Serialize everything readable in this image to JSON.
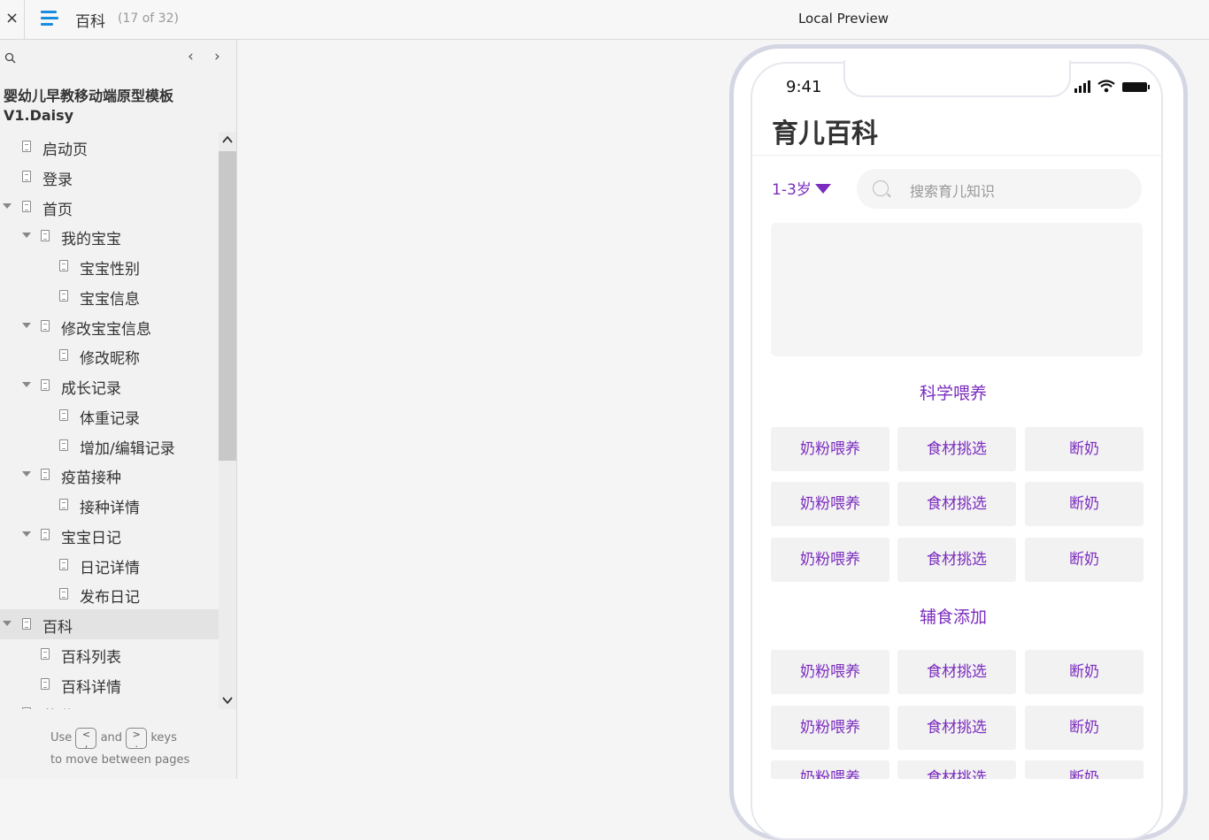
{
  "topbar": {
    "close_label": "×",
    "page_name": "百科",
    "page_count": "(17 of 32)",
    "preview_title": "Local Preview"
  },
  "sidebar": {
    "prev_label": "‹",
    "next_label": "›",
    "project_title_line1": "婴幼儿早教移动端原型模板",
    "project_title_line2": "V1.Daisy",
    "items": [
      {
        "label": "启动页"
      },
      {
        "label": "登录"
      },
      {
        "label": "首页"
      },
      {
        "label": "我的宝宝"
      },
      {
        "label": "宝宝性别"
      },
      {
        "label": "宝宝信息"
      },
      {
        "label": "修改宝宝信息"
      },
      {
        "label": "修改昵称"
      },
      {
        "label": "成长记录"
      },
      {
        "label": "体重记录"
      },
      {
        "label": "增加/编辑记录"
      },
      {
        "label": "疫苗接种"
      },
      {
        "label": "接种详情"
      },
      {
        "label": "宝宝日记"
      },
      {
        "label": "日记详情"
      },
      {
        "label": "发布日记"
      },
      {
        "label": "百科"
      },
      {
        "label": "百科列表"
      },
      {
        "label": "百科详情"
      },
      {
        "label": "菜谱"
      }
    ],
    "hint_use": "Use",
    "hint_and": "and",
    "hint_keys": "keys",
    "hint_line2": "to move between pages",
    "key_prev": "<\n,",
    "key_next": ">\n."
  },
  "phone": {
    "time": "9:41",
    "title": "育儿百科",
    "age_filter": "1-3岁",
    "search_placeholder": "搜索育儿知识",
    "section1_title": "科学喂养",
    "section2_title": "辅食添加",
    "grid_labels": [
      "奶粉喂养",
      "食材挑选",
      "断奶"
    ]
  }
}
